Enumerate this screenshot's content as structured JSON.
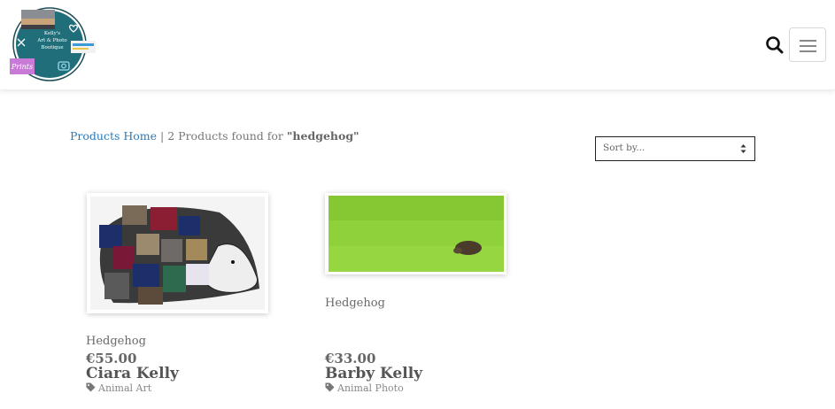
{
  "brand": {
    "logo_text_line1": "Kelly's",
    "logo_text_line2": "Art & Photo",
    "logo_text_line3": "Boutique",
    "logo_sticker": "Prints",
    "circle_color": "#1f6e7a"
  },
  "header": {
    "search_icon": "search-icon",
    "menu_icon": "hamburger-menu-icon"
  },
  "breadcrumb": {
    "home_label": "Products Home",
    "separator": "|",
    "result_text": "2 Products found for",
    "query": "\"hedgehog\""
  },
  "sort": {
    "label": "Sort by..."
  },
  "products": [
    {
      "title": "Hedgehog",
      "price": "€55.00",
      "artist": "Ciara Kelly",
      "category": "Animal Art",
      "image": "patchwork-fabric-hedgehog-artwork"
    },
    {
      "title": "Hedgehog",
      "price": "€33.00",
      "artist": "Barby Kelly",
      "category": "Animal Photo",
      "image": "hedgehog-on-green-grass-photo"
    }
  ],
  "colors": {
    "link": "#2a7ab8",
    "text": "#555555",
    "grass": "#8fd13a"
  }
}
